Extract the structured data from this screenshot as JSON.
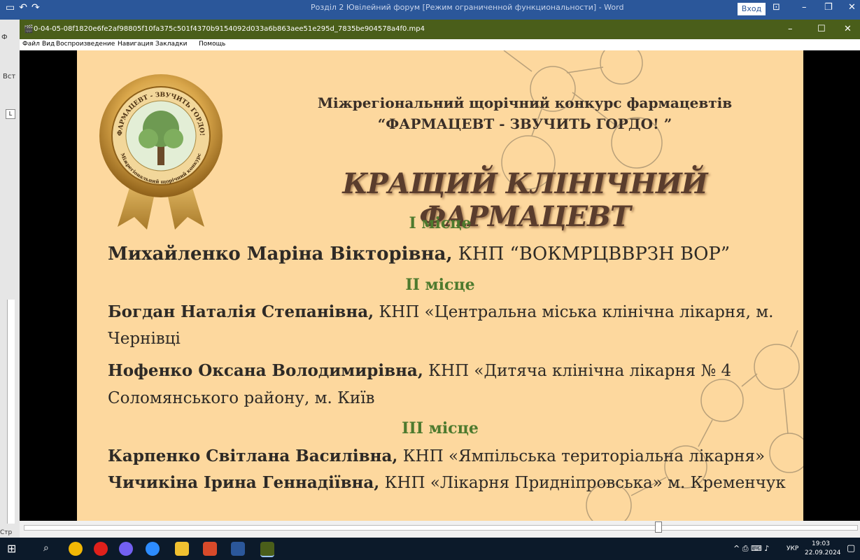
{
  "word": {
    "title": "Розділ 2 Ювілейний форум [Режим ограниченной функциональности] - Word",
    "signin": "Вход",
    "left_label_1": "Вст",
    "left_label_2": "Ф",
    "status_label": "Стр"
  },
  "player": {
    "title": "0-04-05-08f1820e6fe2af98805f10fa375c501f4370b9154092d033a6b863aee51e295d_7835be904578a4f0.mp4",
    "menu": [
      "Файл",
      "Вид",
      "Воспроизведение",
      "Навигация",
      "Закладки",
      "Помощь"
    ],
    "progress": 0.76
  },
  "slide": {
    "header_line1": "Міжрегіональний щорічний  конкурс фармацевтів",
    "header_line2": "“ФАРМАЦЕВТ - ЗВУЧИТЬ ГОРДО! ”",
    "main_title": "КРАЩИЙ КЛІНІЧНИЙ ФАРМАЦЕВТ",
    "medal_text_top": "ФАРМАЦЕВТ - ЗВУЧИТЬ ГОРДО!",
    "medal_text_bottom": "Міжрегіональний щорічний конкурс",
    "place1": "І місце",
    "winner1_name": "Михайленко Маріна Вікторівна,",
    "winner1_org": " КНП “ВОКМРЦВВРЗН ВОР”",
    "place2": "ІІ місце",
    "winner2_name": "Богдан Наталія Степанівна,",
    "winner2_org": " КНП «Центральна міська клінічна лікарня, м.",
    "winner2_org2": "Чернівці",
    "winner3_name": "Нофенко Оксана Володимирівна,",
    "winner3_org": " КНП «Дитяча клінічна лікарня № 4",
    "winner3_org2": "Соломянського району, м. Київ",
    "place3": "ІІІ місце",
    "winner4_name": "Карпенко Світлана Василівна,",
    "winner4_org": " КНП «Ямпільська територіальна лікарня»",
    "winner5_name": "Чичикіна Ірина Геннадіївна,",
    "winner5_org": " КНП «Лікарня Придніпровська» м. Кременчук"
  },
  "taskbar": {
    "lang": "УКР",
    "time": "19:03",
    "date": "22.09.2024",
    "apps": [
      "windows-start-icon",
      "search-icon",
      "chrome-icon",
      "opera-icon",
      "viber-icon",
      "zoom-icon",
      "file-explorer-icon",
      "mobile-app-icon",
      "word-icon",
      "media-player-icon"
    ]
  },
  "colors": {
    "slide_bg": "#fdd89e",
    "place_green": "#4d7a2e",
    "player_title_bg": "#4a5e1a",
    "word_blue": "#2b579a"
  }
}
